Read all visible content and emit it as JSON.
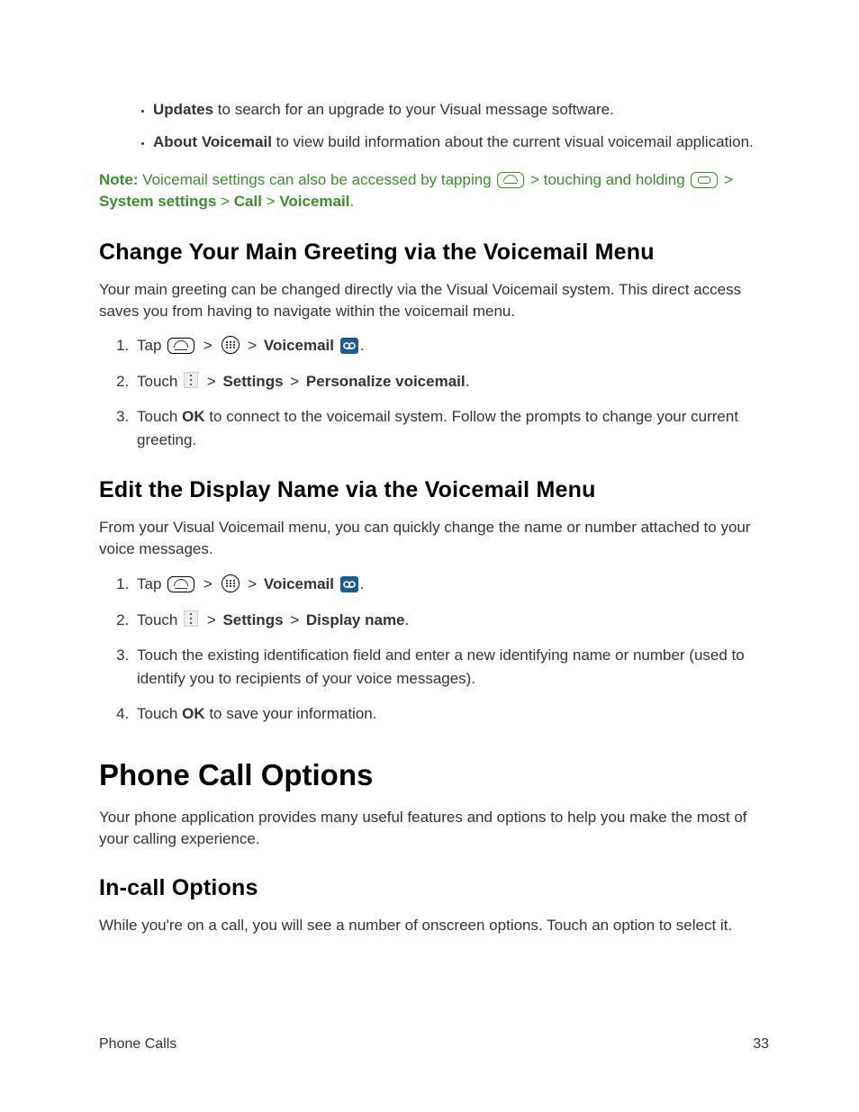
{
  "bullets_intro": [
    {
      "bold": "Updates",
      "rest": " to search for an upgrade to your Visual message software."
    },
    {
      "bold": "About Voicemail",
      "rest": " to view build information about the current visual voicemail application."
    }
  ],
  "note": {
    "label": "Note:",
    "part1": " Voicemail settings can also be accessed by tapping ",
    "part2": " > touching and holding ",
    "part3": " > ",
    "seg_system": "System settings",
    "gt1": " > ",
    "seg_call": "Call",
    "gt2": " > ",
    "seg_vm": "Voicemail",
    "period": "."
  },
  "sec1": {
    "heading": "Change Your Main Greeting via the Voicemail Menu",
    "intro": "Your main greeting can be changed directly via the Visual Voicemail system. This direct access saves you from having to navigate within the voicemail menu.",
    "steps": {
      "s1": {
        "tap": "Tap ",
        "gt": " > ",
        "vm": "Voicemail",
        "period": "."
      },
      "s2": {
        "touch": "Touch ",
        "gt": " > ",
        "settings": "Settings",
        "gt2": " > ",
        "pv": "Personalize voicemail",
        "period": "."
      },
      "s3": {
        "pre": "Touch ",
        "ok": "OK",
        "rest": " to connect to the voicemail system. Follow the prompts to change your current greeting."
      }
    }
  },
  "sec2": {
    "heading": "Edit the Display Name via the Voicemail Menu",
    "intro": "From your Visual Voicemail menu, you can quickly change the name or number attached to your voice messages.",
    "steps": {
      "s1": {
        "tap": "Tap ",
        "gt": " > ",
        "vm": "Voicemail",
        "period": "."
      },
      "s2": {
        "touch": "Touch ",
        "gt": " > ",
        "settings": "Settings",
        "gt2": " > ",
        "dn": "Display name",
        "period": "."
      },
      "s3": "Touch the existing identification field and enter a new identifying name or number (used to identify you to recipients of your voice messages).",
      "s4": {
        "pre": "Touch ",
        "ok": "OK",
        "rest": " to save your information."
      }
    }
  },
  "sec3": {
    "heading": "Phone Call Options",
    "intro": "Your phone application provides many useful features and options to help you make the most of your calling experience."
  },
  "sec4": {
    "heading": "In-call Options",
    "intro": "While you're on a call, you will see a number of onscreen options. Touch an option to select it."
  },
  "footer": {
    "left": "Phone Calls",
    "right": "33"
  }
}
